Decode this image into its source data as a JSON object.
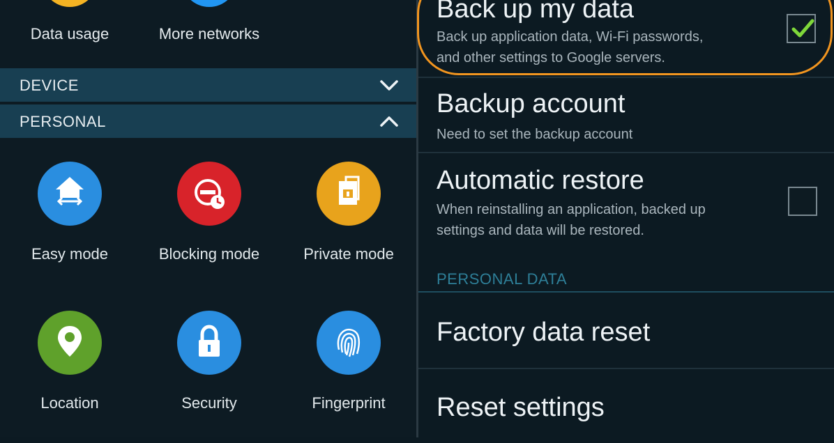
{
  "left": {
    "top_items": [
      {
        "label": "Data usage",
        "color": "#f4b323"
      },
      {
        "label": "More networks",
        "color": "#2196f3"
      }
    ],
    "sections": {
      "device": "DEVICE",
      "personal": "PERSONAL"
    },
    "grid": [
      {
        "label": "Easy mode",
        "icon": "easy-mode-icon",
        "color": "#2a8ee0"
      },
      {
        "label": "Blocking mode",
        "icon": "blocking-mode-icon",
        "color": "#d8232a"
      },
      {
        "label": "Private mode",
        "icon": "private-mode-icon",
        "color": "#e8a31c"
      },
      {
        "label": "Location",
        "icon": "location-icon",
        "color": "#5fa12b"
      },
      {
        "label": "Security",
        "icon": "lock-icon",
        "color": "#2a8ee0"
      },
      {
        "label": "Fingerprint",
        "icon": "fingerprint-icon",
        "color": "#2a8ee0"
      }
    ]
  },
  "right": {
    "backup": {
      "title": "Back up my data",
      "sub1": "Back up application data, Wi-Fi passwords,",
      "sub2": "and other settings to Google servers.",
      "checked": true
    },
    "account": {
      "title": "Backup account",
      "sub": "Need to set the backup account"
    },
    "restore": {
      "title": "Automatic restore",
      "sub1": "When reinstalling an application, backed up",
      "sub2": "settings and data will be restored.",
      "checked": false
    },
    "personal_data_label": "PERSONAL DATA",
    "factory_reset": "Factory data reset",
    "reset_settings": "Reset settings"
  },
  "colors": {
    "highlight": "#f2951f",
    "check": "#7fd83a",
    "section_bar": "#183f52"
  }
}
